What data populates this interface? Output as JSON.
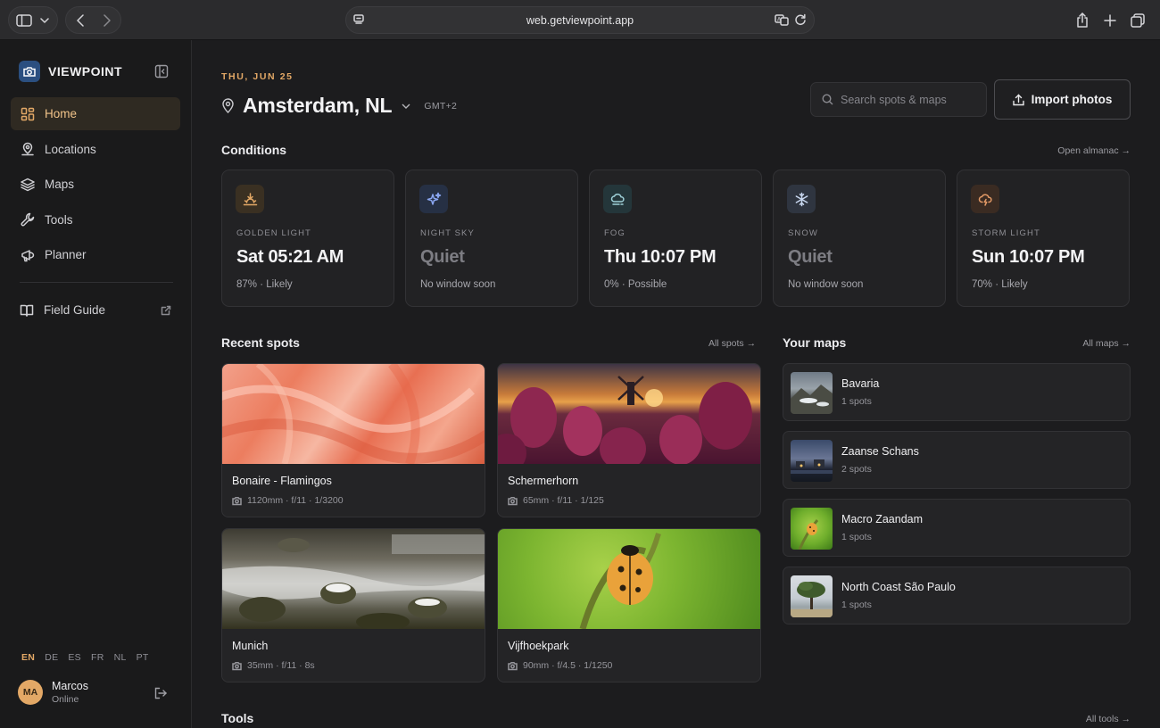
{
  "browser": {
    "url": "web.getviewpoint.app"
  },
  "sidebar": {
    "brand": "VIEWPOINT",
    "items": [
      {
        "label": "Home",
        "icon": "grid-icon"
      },
      {
        "label": "Locations",
        "icon": "pin-user-icon"
      },
      {
        "label": "Maps",
        "icon": "layers-icon"
      },
      {
        "label": "Tools",
        "icon": "wrench-icon"
      },
      {
        "label": "Planner",
        "icon": "megaphone-icon"
      }
    ],
    "field_guide": "Field Guide",
    "languages": [
      "EN",
      "DE",
      "ES",
      "FR",
      "NL",
      "PT"
    ],
    "active_language": "EN",
    "user": {
      "initials": "MA",
      "name": "Marcos",
      "status": "Online"
    }
  },
  "header": {
    "date": "THU, JUN 25",
    "location": "Amsterdam, NL",
    "timezone": "GMT+2",
    "search_placeholder": "Search spots & maps",
    "import_label": "Import photos"
  },
  "conditions": {
    "title": "Conditions",
    "link": "Open almanac →",
    "cards": [
      {
        "label": "GOLDEN LIGHT",
        "value": "Sat 05:21 AM",
        "sub": "87% · Likely",
        "icon": "sunrise-icon",
        "dim": false,
        "icon_color": "#e3a866",
        "icon_bg": "#3a3022"
      },
      {
        "label": "NIGHT SKY",
        "value": "Quiet",
        "sub": "No window soon",
        "icon": "sparkle-icon",
        "dim": true,
        "icon_color": "#8aa6f0",
        "icon_bg": "#263044"
      },
      {
        "label": "FOG",
        "value": "Thu 10:07 PM",
        "sub": "0% · Possible",
        "icon": "fog-cloud-icon",
        "dim": false,
        "icon_color": "#9fd0d8",
        "icon_bg": "#24363a"
      },
      {
        "label": "SNOW",
        "value": "Quiet",
        "sub": "No window soon",
        "icon": "snowflake-icon",
        "dim": true,
        "icon_color": "#c9d8f0",
        "icon_bg": "#2f3540"
      },
      {
        "label": "STORM LIGHT",
        "value": "Sun 10:07 PM",
        "sub": "70% · Likely",
        "icon": "storm-cloud-icon",
        "dim": false,
        "icon_color": "#e39a66",
        "icon_bg": "#3a2b22"
      }
    ]
  },
  "recent_spots": {
    "title": "Recent spots",
    "link": "All spots →",
    "items": [
      {
        "name": "Bonaire - Flamingos",
        "meta": "1120mm · f/11 · 1/3200"
      },
      {
        "name": "Schermerhorn",
        "meta": "65mm · f/11 · 1/125"
      },
      {
        "name": "Munich",
        "meta": "35mm · f/11 · 8s"
      },
      {
        "name": "Vijfhoekpark",
        "meta": "90mm · f/4.5 · 1/1250"
      }
    ]
  },
  "maps": {
    "title": "Your maps",
    "link": "All maps →",
    "items": [
      {
        "name": "Bavaria",
        "count": "1 spots"
      },
      {
        "name": "Zaanse Schans",
        "count": "2 spots"
      },
      {
        "name": "Macro Zaandam",
        "count": "1 spots"
      },
      {
        "name": "North Coast São Paulo",
        "count": "1 spots"
      }
    ]
  },
  "tools": {
    "title": "Tools",
    "link": "All tools →"
  }
}
